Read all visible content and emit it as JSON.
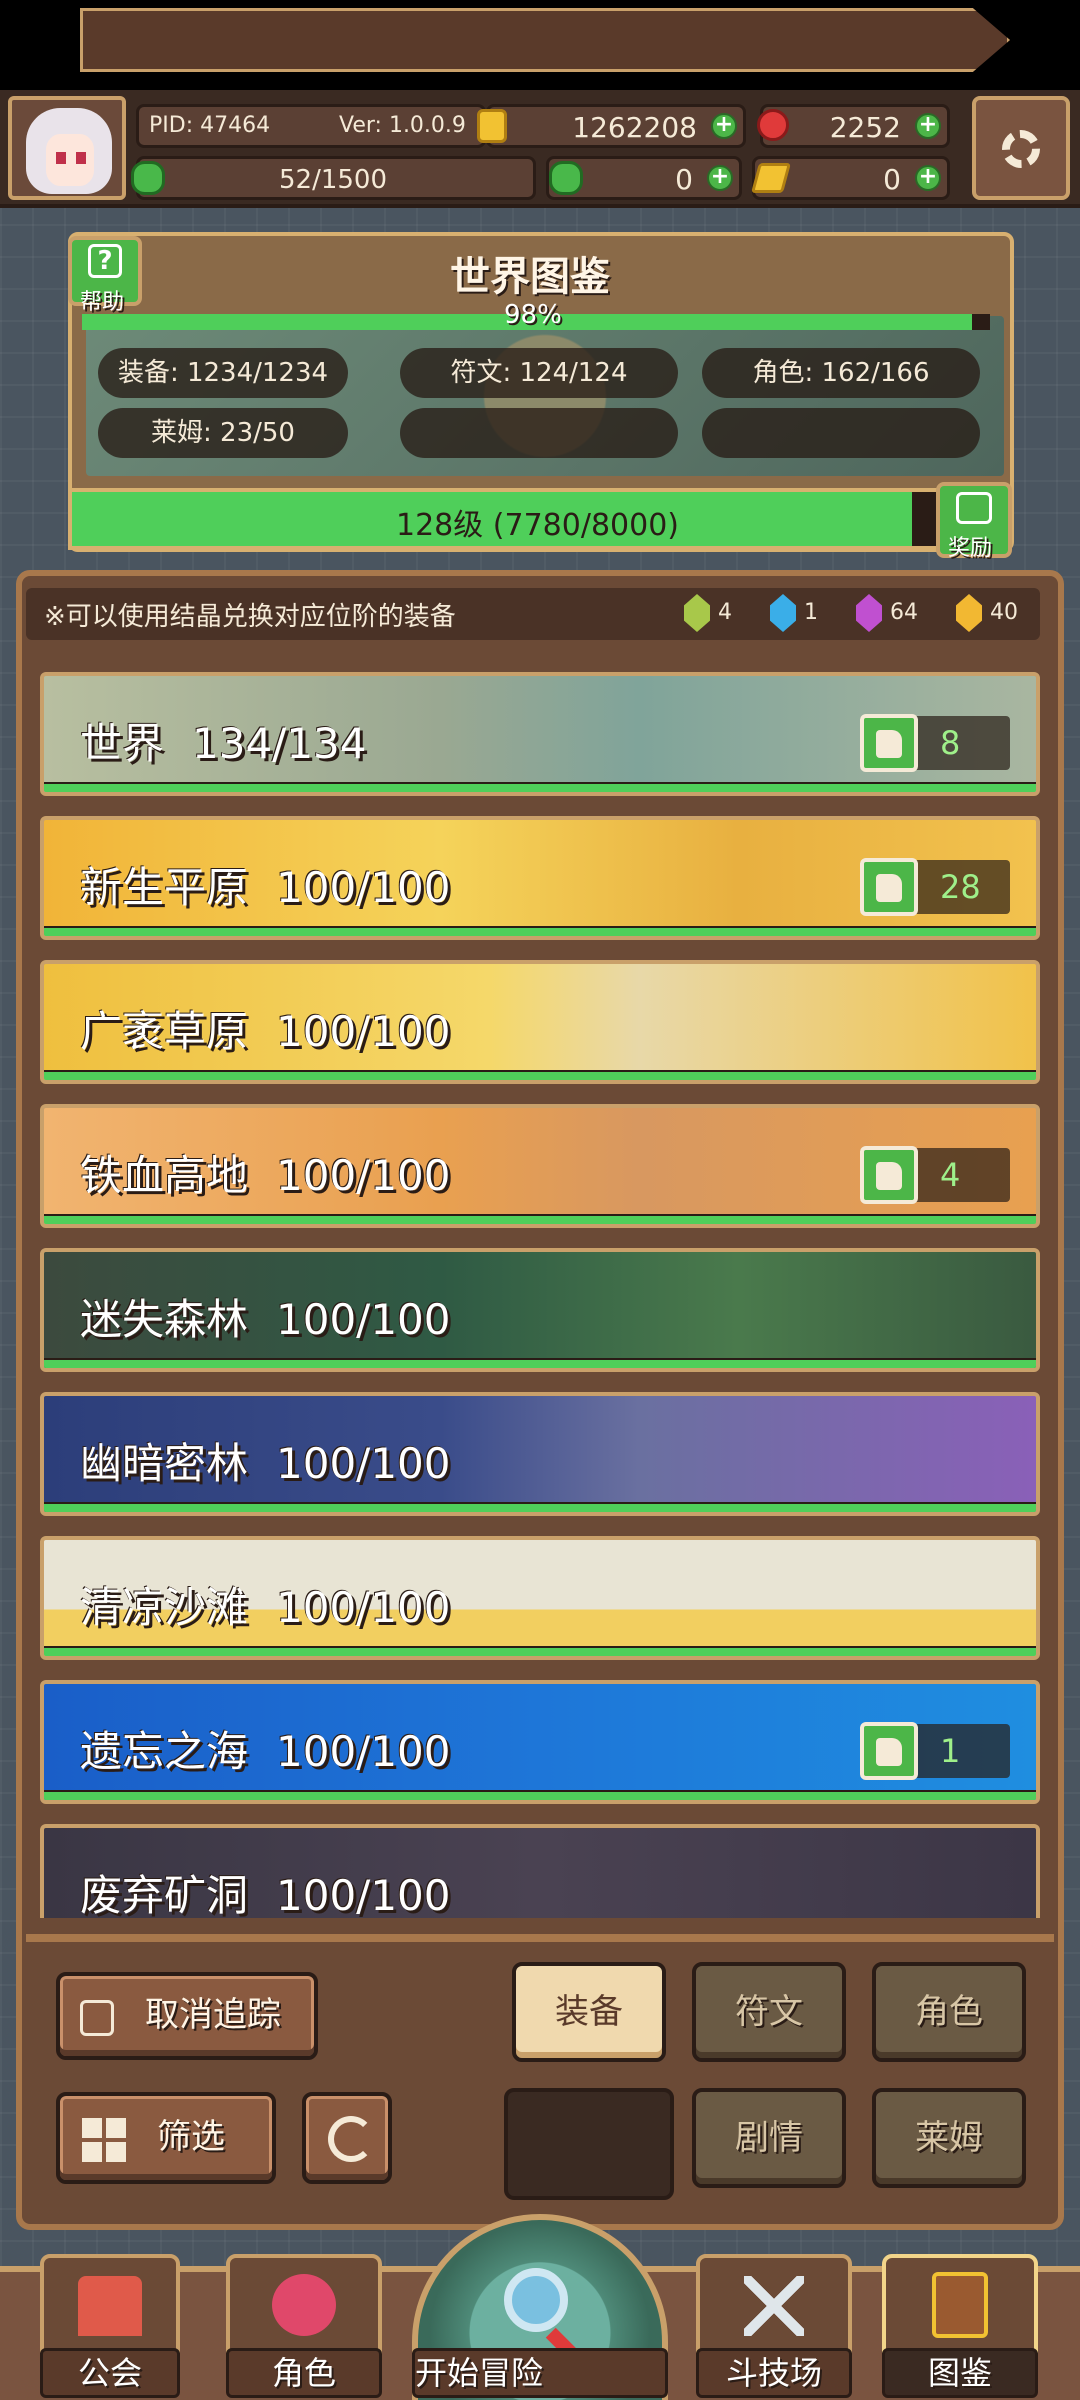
{
  "player": {
    "pid": "PID: 47464",
    "version": "Ver: 1.0.0.9",
    "gold": "1262208",
    "gems": "2252",
    "exp": "52/1500",
    "clover": "0",
    "keys": "0"
  },
  "atlas": {
    "title": "世界图鉴",
    "help_label": "帮助",
    "percent_label": "98%",
    "percent_value": 98,
    "stats": {
      "equipment": "装备: 1234/1234",
      "runes": "符文: 124/124",
      "characters": "角色: 162/166",
      "slime": "莱姆: 23/50"
    },
    "level_label": "128级 (7780/8000)",
    "level_progress": 0.9725,
    "reward_label": "奖励"
  },
  "notice": "※可以使用结晶兑换对应位阶的装备",
  "crystals": [
    {
      "count": "4",
      "color": "#a8c84a"
    },
    {
      "count": "1",
      "color": "#3aaee8"
    },
    {
      "count": "64",
      "color": "#c050d0"
    },
    {
      "count": "40",
      "color": "#f2b832"
    }
  ],
  "regions": [
    {
      "name": "世界",
      "progress": "134/134",
      "likes": "8",
      "theme": "world"
    },
    {
      "name": "新生平原",
      "progress": "100/100",
      "likes": "28",
      "theme": "plain"
    },
    {
      "name": "广袤草原",
      "progress": "100/100",
      "likes": "",
      "theme": "grass"
    },
    {
      "name": "铁血高地",
      "progress": "100/100",
      "likes": "4",
      "theme": "highland"
    },
    {
      "name": "迷失森林",
      "progress": "100/100",
      "likes": "",
      "theme": "forest"
    },
    {
      "name": "幽暗密林",
      "progress": "100/100",
      "likes": "",
      "theme": "dark"
    },
    {
      "name": "清凉沙滩",
      "progress": "100/100",
      "likes": "",
      "theme": "beach"
    },
    {
      "name": "遗忘之海",
      "progress": "100/100",
      "likes": "1",
      "theme": "sea"
    },
    {
      "name": "废弃矿洞",
      "progress": "100/100",
      "likes": "",
      "theme": "mine"
    }
  ],
  "controls": {
    "untrack": "取消追踪",
    "filter": "筛选",
    "tabs": {
      "equipment": "装备",
      "runes": "符文",
      "characters": "角色",
      "story": "剧情",
      "slime": "莱姆"
    }
  },
  "nav": {
    "guild": "公会",
    "character": "角色",
    "adventure": "开始冒险",
    "arena": "斗技场",
    "atlas": "图鉴"
  }
}
